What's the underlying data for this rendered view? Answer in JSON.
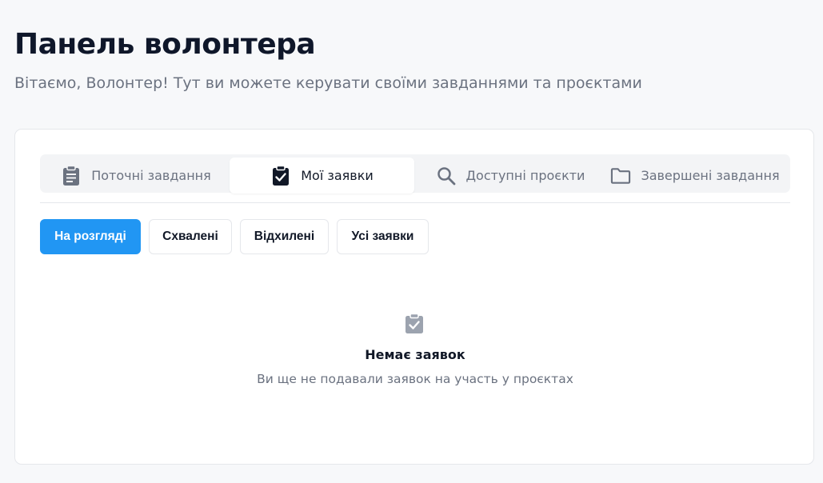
{
  "header": {
    "title": "Панель волонтера",
    "subtitle": "Вітаємо, Волонтер! Тут ви можете керувати своїми завданнями та проєктами"
  },
  "tabs": [
    {
      "label": "Поточні завдання",
      "icon": "clipboard-list-icon",
      "active": false
    },
    {
      "label": "Мої заявки",
      "icon": "clipboard-check-icon",
      "active": true
    },
    {
      "label": "Доступні проєкти",
      "icon": "search-icon",
      "active": false
    },
    {
      "label": "Завершені завдання",
      "icon": "folder-icon",
      "active": false
    }
  ],
  "filters": [
    {
      "label": "На розгляді",
      "active": true
    },
    {
      "label": "Схвалені",
      "active": false
    },
    {
      "label": "Відхилені",
      "active": false
    },
    {
      "label": "Усі заявки",
      "active": false
    }
  ],
  "empty_state": {
    "icon": "clipboard-check-icon",
    "title": "Немає заявок",
    "text": "Ви ще не подавали заявок на участь у проєктах"
  },
  "colors": {
    "accent": "#2196f3",
    "background": "#f7f8fa",
    "muted_text": "#6b7280",
    "icon_gray": "#6b7280"
  }
}
